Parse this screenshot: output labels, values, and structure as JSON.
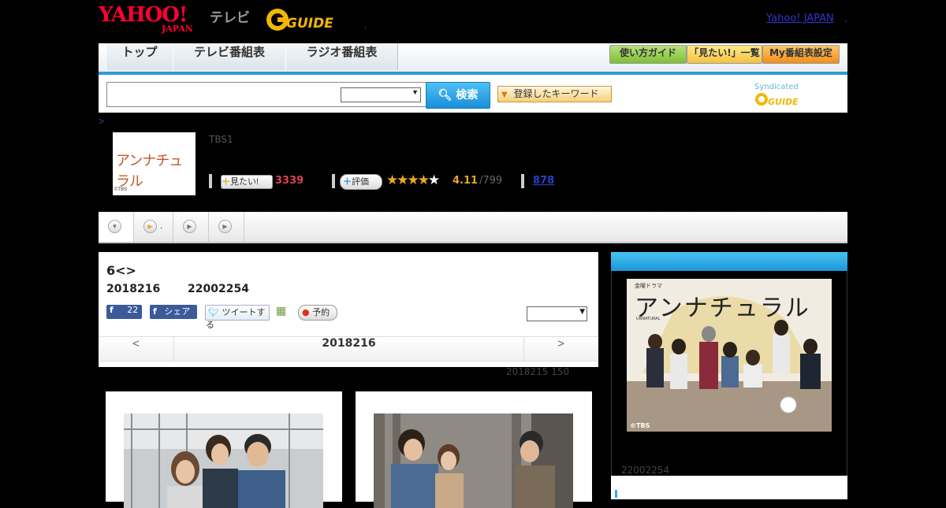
{
  "header": {
    "yahoo_logo_main": "YAHOO!",
    "yahoo_logo_sub": "JAPAN",
    "tv_label": "テレビ",
    "gguide_logo": "GUIDE",
    "yahoo_japan_link": "Yahoo! JAPAN",
    "dot_sep": ".",
    "comma_sep": ","
  },
  "nav": {
    "tabs": [
      "トップ",
      "テレビ番組表",
      "ラジオ番組表"
    ],
    "buttons": [
      "使い方ガイド",
      "「見たい!」一覧",
      "My番組表設定"
    ]
  },
  "search": {
    "placeholder": "",
    "select_value": "",
    "button_label": "検索",
    "keyword_button": "登録したキーワード",
    "syndicated_label": "Syndicated"
  },
  "breadcrumb": ">",
  "program": {
    "thumb_title": "アンナチュラル",
    "thumb_credit": "©TBS",
    "channel": "TBS1",
    "mitai_label": "見たい!",
    "mitai_count": "3339",
    "hyoka_label": "評価",
    "stars": "★★★★★",
    "rating": "4.11",
    "rating_count": "/799",
    "review_count": "878"
  },
  "tabstrip": {
    "tab2_suffix": "."
  },
  "episode": {
    "title": "6<>",
    "date": "2018216",
    "time": "22002254",
    "like_count": "22",
    "share_label": "シェア",
    "tweet_label": "ツイートする",
    "reserve_label": "予約",
    "select_value": "",
    "pager_prev": "<",
    "pager_date": "2018216",
    "pager_next": ">",
    "updated": "2018215  150"
  },
  "sidebar": {
    "poster_tag": "金曜ドラマ",
    "poster_title": "アンナチュラル",
    "poster_sub": "UNNATURAL",
    "poster_credit": "©TBS",
    "time": "22002254"
  },
  "colors": {
    "accent_blue": "#2f9bd6",
    "yahoo_red": "#ff0033",
    "count_red": "#e0405a",
    "rating_orange": "#e8a42e",
    "nav_button_green": "#8cc63f",
    "nav_button_orange": "#f4a62a"
  }
}
